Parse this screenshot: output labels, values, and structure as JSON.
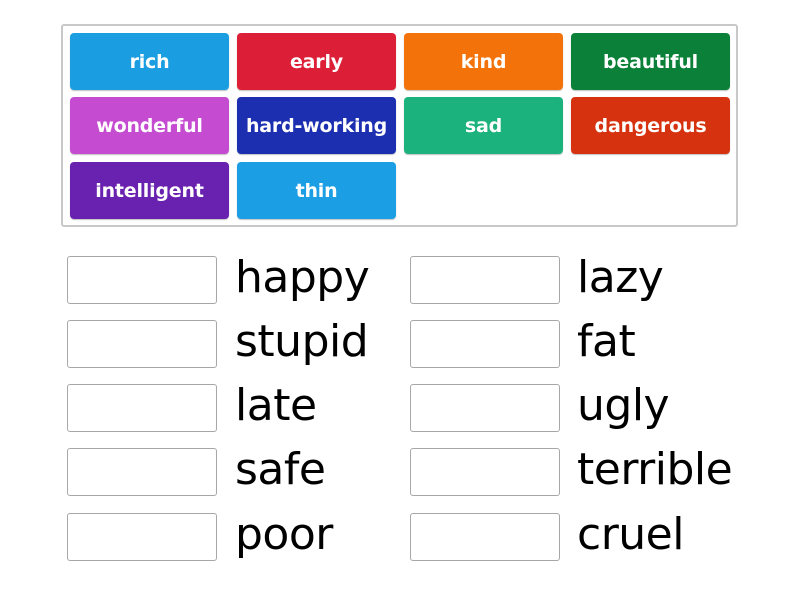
{
  "tiles": [
    {
      "label": "rich",
      "color": "#1a9ee1"
    },
    {
      "label": "early",
      "color": "#dc1f36"
    },
    {
      "label": "kind",
      "color": "#f37209"
    },
    {
      "label": "beautiful",
      "color": "#0b8038"
    },
    {
      "label": "wonderful",
      "color": "#c54bd1"
    },
    {
      "label": "hard-working",
      "color": "#1c2fb0"
    },
    {
      "label": "sad",
      "color": "#1cb27e"
    },
    {
      "label": "dangerous",
      "color": "#d6320f"
    },
    {
      "label": "intelligent",
      "color": "#6921b0"
    },
    {
      "label": "thin",
      "color": "#1b9ee4"
    }
  ],
  "targets_left": [
    {
      "word": "happy"
    },
    {
      "word": "stupid"
    },
    {
      "word": "late"
    },
    {
      "word": "safe"
    },
    {
      "word": "poor"
    }
  ],
  "targets_right": [
    {
      "word": "lazy"
    },
    {
      "word": "fat"
    },
    {
      "word": "ugly"
    },
    {
      "word": "terrible"
    },
    {
      "word": "cruel"
    }
  ]
}
